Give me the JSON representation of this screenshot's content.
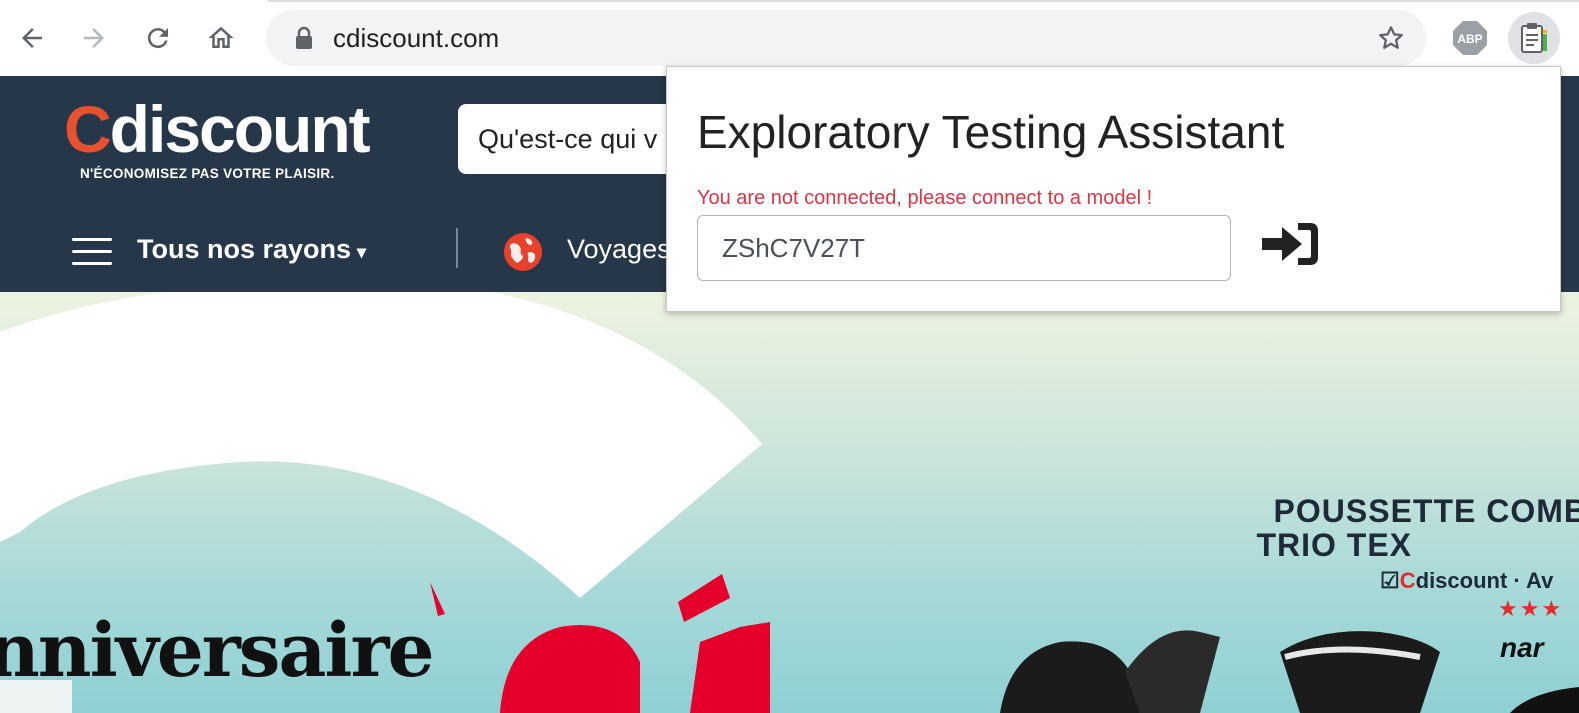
{
  "browser": {
    "url": "cdiscount.com",
    "extensions": [
      {
        "name": "adblock-plus",
        "label": "ABP"
      },
      {
        "name": "exploratory-testing-assistant",
        "label": ""
      }
    ]
  },
  "site": {
    "logo_text": "Cdiscount",
    "logo_first_letter": "C",
    "logo_rest": "discount",
    "tagline": "N'ÉCONOMISEZ PAS VOTRE PLAISIR.",
    "search_placeholder": "Qu'est-ce qui v",
    "nav": {
      "all_departments": "Tous nos rayons",
      "caret": "▾",
      "travel": "Voyages"
    },
    "banner": {
      "anniversary_text": "nniversaire",
      "product_title_line1": "POUSSETTE COMBIN",
      "product_title_line2": "TRIO TEX",
      "product_brand_prefix": "☑",
      "product_brand_c": "C",
      "product_brand_rest": "discount · Av",
      "product_stars": "★★★",
      "product_maker": "nar"
    }
  },
  "popup": {
    "title": "Exploratory Testing Assistant",
    "error": "You are not connected, please connect to a model !",
    "model_id_value": "ZShC7V27T"
  },
  "colors": {
    "header_bg": "#263749",
    "logo_accent": "#e8512f",
    "error_text": "#dc3545",
    "omnibox_bg": "#f1f3f4"
  }
}
